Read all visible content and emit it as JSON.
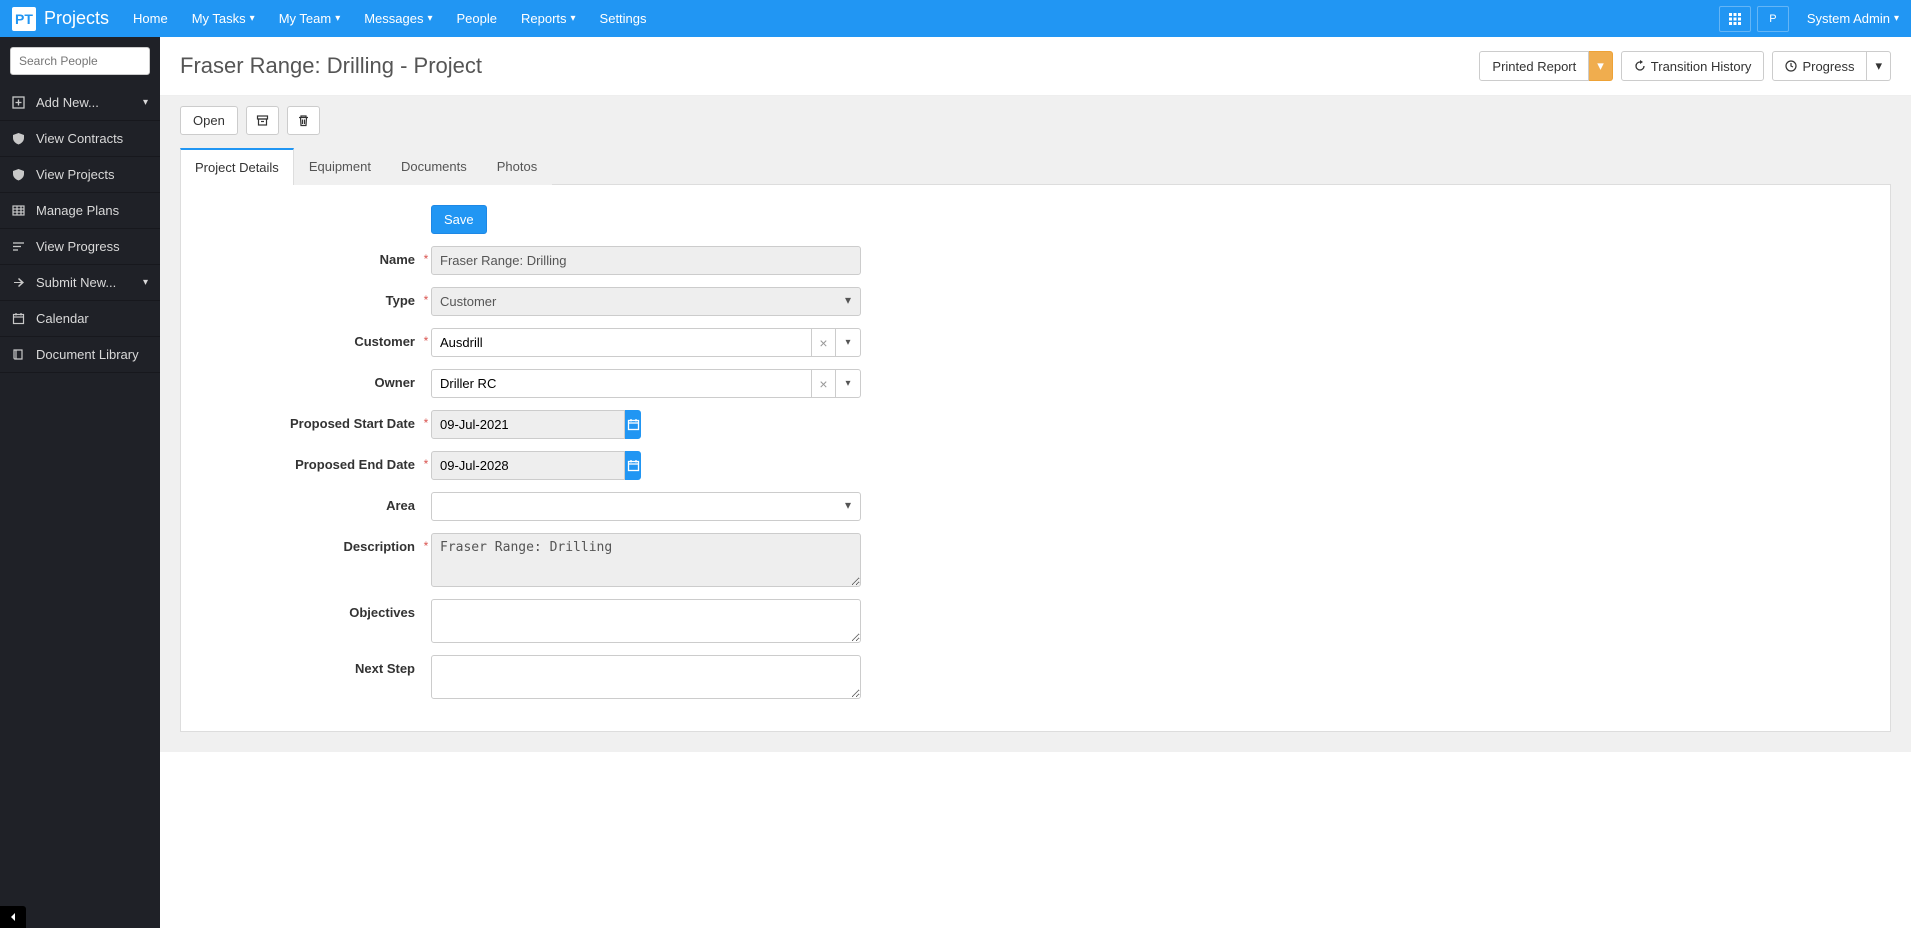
{
  "brand": {
    "logo_text": "PT",
    "name": "Projects"
  },
  "topnav": {
    "home": "Home",
    "my_tasks": "My Tasks",
    "my_team": "My Team",
    "messages": "Messages",
    "people": "People",
    "reports": "Reports",
    "settings": "Settings",
    "p_badge": "P",
    "user_menu": "System Admin"
  },
  "sidebar": {
    "search_placeholder": "Search People",
    "add_new": "Add New...",
    "view_contracts": "View Contracts",
    "view_projects": "View Projects",
    "manage_plans": "Manage Plans",
    "view_progress": "View Progress",
    "submit_new": "Submit New...",
    "calendar": "Calendar",
    "document_library": "Document Library"
  },
  "page": {
    "title": "Fraser Range: Drilling - Project",
    "printed_report": "Printed Report",
    "transition_history": "Transition History",
    "progress": "Progress",
    "open": "Open"
  },
  "tabs": {
    "project_details": "Project Details",
    "equipment": "Equipment",
    "documents": "Documents",
    "photos": "Photos"
  },
  "form": {
    "save": "Save",
    "name_label": "Name",
    "name_value": "Fraser Range: Drilling",
    "type_label": "Type",
    "type_value": "Customer",
    "customer_label": "Customer",
    "customer_value": "Ausdrill",
    "owner_label": "Owner",
    "owner_value": "Driller RC",
    "start_label": "Proposed Start Date",
    "start_value": "09-Jul-2021",
    "end_label": "Proposed End Date",
    "end_value": "09-Jul-2028",
    "area_label": "Area",
    "area_value": "",
    "description_label": "Description",
    "description_value": "Fraser Range: Drilling",
    "objectives_label": "Objectives",
    "objectives_value": "",
    "next_step_label": "Next Step",
    "next_step_value": ""
  }
}
